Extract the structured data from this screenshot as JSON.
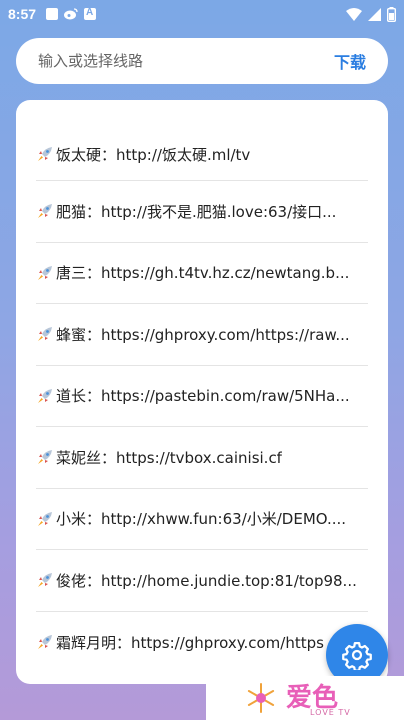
{
  "status_bar": {
    "time": "8:57",
    "icons_left": [
      "image-icon",
      "weibo-icon",
      "a-icon"
    ],
    "icons_right": [
      "wifi-icon",
      "signal-icon",
      "battery-icon"
    ]
  },
  "search": {
    "placeholder": "输入或选择线路",
    "value": "",
    "download_label": "下载"
  },
  "routes": [
    {
      "icon": "rocket-icon",
      "text": "饭太硬：http://饭太硬.ml/tv"
    },
    {
      "icon": "rocket-icon",
      "text": "肥猫：http://我不是.肥猫.love:63/接口..."
    },
    {
      "icon": "rocket-icon",
      "text": "唐三：https://gh.t4tv.hz.cz/newtang.b..."
    },
    {
      "icon": "rocket-icon",
      "text": "蜂蜜：https://ghproxy.com/https://raw..."
    },
    {
      "icon": "rocket-icon",
      "text": "道长：https://pastebin.com/raw/5NHa..."
    },
    {
      "icon": "rocket-icon",
      "text": "菜妮丝：https://tvbox.cainisi.cf"
    },
    {
      "icon": "rocket-icon",
      "text": "小米：http://xhww.fun:63/小米/DEMO...."
    },
    {
      "icon": "rocket-icon",
      "text": "俊佬：http://home.jundie.top:81/top98..."
    },
    {
      "icon": "rocket-icon",
      "text": "霜辉月明：https://ghproxy.com/https"
    }
  ],
  "fab": {
    "icon": "gear-icon"
  },
  "watermark": {
    "logo": "爱色",
    "sub": "LOVE TV"
  },
  "colors": {
    "accent": "#2f86e8",
    "download": "#2a7de1",
    "watermark": "#e85fb8"
  }
}
